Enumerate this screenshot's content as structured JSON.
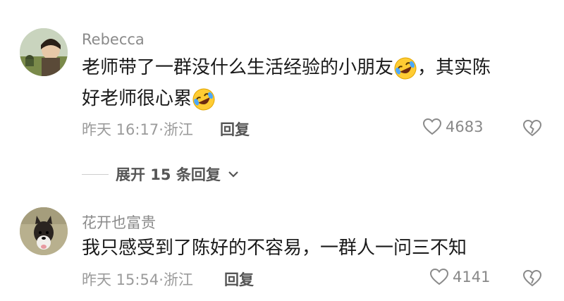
{
  "comments": [
    {
      "username": "Rebecca",
      "text_line1": "老师带了一群没什么生活经验的小朋友",
      "text_line1_end": "，其实陈",
      "text_line2": "好老师很心累",
      "time": "昨天 16:17·浙江",
      "reply_label": "回复",
      "likes": "4683",
      "emoji": "rolling-on-floor-laughing-emoji"
    },
    {
      "username": "花开也富贵",
      "text_line1": "我只感受到了陈好的不容易，一群人一问三不知",
      "time": "昨天 15:54·浙江",
      "reply_label": "回复",
      "likes": "4141"
    }
  ],
  "expand_replies": {
    "label": "展开 15 条回复"
  },
  "colors": {
    "text": "#1a1a1a",
    "meta": "#9b9b9b",
    "username": "#8a8a8a"
  }
}
